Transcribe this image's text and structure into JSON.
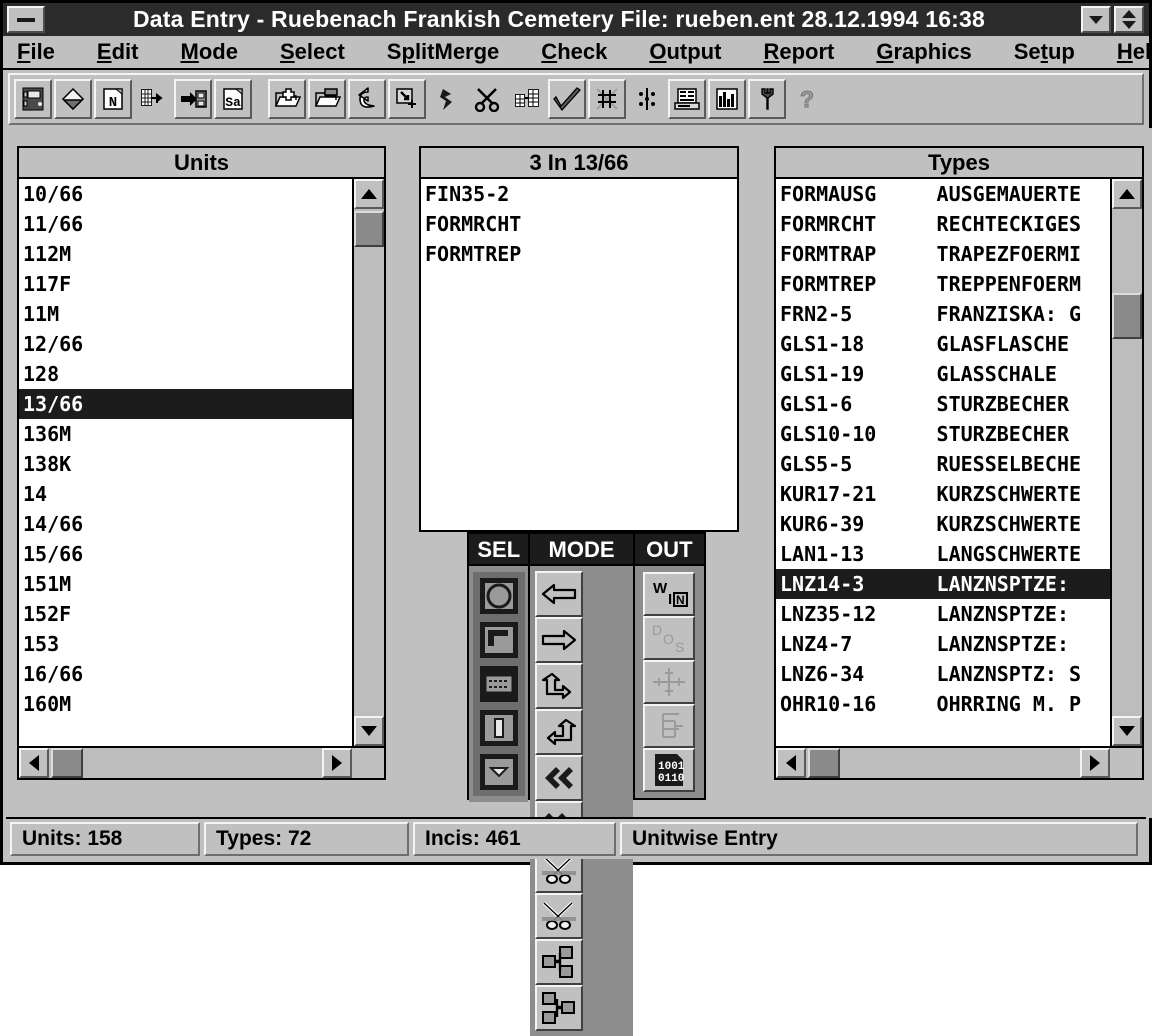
{
  "window": {
    "title": "Data Entry - Ruebenach Frankish Cemetery File: rueben.ent 28.12.1994 16:38",
    "minimize_icon": "minimize-icon",
    "restore_icon": "chevron-down-icon",
    "maximize_icon": "up-down-arrow-icon"
  },
  "menubar": {
    "items": [
      {
        "label": "File",
        "accel": "F"
      },
      {
        "label": "Edit",
        "accel": "E"
      },
      {
        "label": "Mode",
        "accel": "M"
      },
      {
        "label": "Select",
        "accel": "S"
      },
      {
        "label": "SplitMerge",
        "accel": "p"
      },
      {
        "label": "Check",
        "accel": "C"
      },
      {
        "label": "Output",
        "accel": "O"
      },
      {
        "label": "Report",
        "accel": "R"
      },
      {
        "label": "Graphics",
        "accel": "G"
      },
      {
        "label": "Setup",
        "accel": "t"
      },
      {
        "label": "Help",
        "accel": "H"
      }
    ]
  },
  "toolbar": {
    "buttons": [
      {
        "name": "save-file-icon"
      },
      {
        "name": "eraser-icon"
      },
      {
        "name": "new-note-icon"
      },
      {
        "name": "grid-insert-icon"
      },
      {
        "name": "export-to-disk-icon"
      },
      {
        "name": "save-as-icon"
      },
      {
        "name": "add-record-folder-icon"
      },
      {
        "name": "open-folder-icon"
      },
      {
        "name": "undo-arrow-icon"
      },
      {
        "name": "add-selection-icon"
      },
      {
        "name": "split-icon"
      },
      {
        "name": "scissors-cut-icon"
      },
      {
        "name": "merge-table-icon"
      },
      {
        "name": "check-mark-icon"
      },
      {
        "name": "seriation-grid-icon"
      },
      {
        "name": "correspondence-dots-icon"
      },
      {
        "name": "printer-icon"
      },
      {
        "name": "bar-chart-icon"
      },
      {
        "name": "wrench-setup-icon"
      },
      {
        "name": "help-question-icon"
      }
    ]
  },
  "units_panel": {
    "title": "Units",
    "selected": "13/66",
    "items": [
      "10/66",
      "11/66",
      "112M",
      "117F",
      "11M",
      "12/66",
      "128",
      "13/66",
      "136M",
      "138K",
      "14",
      "14/66",
      "15/66",
      "151M",
      "152F",
      "153",
      "16/66",
      "160M"
    ],
    "scroll_up_icon": "arrow-up-icon",
    "scroll_down_icon": "arrow-down-icon",
    "scroll_left_icon": "arrow-left-icon",
    "scroll_right_icon": "arrow-right-icon"
  },
  "incidence_panel": {
    "title": "3 In 13/66",
    "items": [
      "FIN35-2",
      "FORMRCHT",
      "FORMTREP"
    ]
  },
  "types_panel": {
    "title": "Types",
    "selected": "LNZ14-3",
    "items": [
      {
        "code": "FORMAUSG",
        "desc": "AUSGEMAUERTE"
      },
      {
        "code": "FORMRCHT",
        "desc": "RECHTECKIGES"
      },
      {
        "code": "FORMTRAP",
        "desc": "TRAPEZFOERMI"
      },
      {
        "code": "FORMTREP",
        "desc": "TREPPENFOERM"
      },
      {
        "code": "FRN2-5",
        "desc": "FRANZISKA: G"
      },
      {
        "code": "GLS1-18",
        "desc": "GLASFLASCHE"
      },
      {
        "code": "GLS1-19",
        "desc": "GLASSCHALE"
      },
      {
        "code": "GLS1-6",
        "desc": "STURZBECHER"
      },
      {
        "code": "GLS10-10",
        "desc": "STURZBECHER"
      },
      {
        "code": "GLS5-5",
        "desc": "RUESSELBECHE"
      },
      {
        "code": "KUR17-21",
        "desc": "KURZSCHWERTE"
      },
      {
        "code": "KUR6-39",
        "desc": "KURZSCHWERTE"
      },
      {
        "code": "LAN1-13",
        "desc": "LANGSCHWERTE"
      },
      {
        "code": "LNZ14-3",
        "desc": "LANZNSPTZE:"
      },
      {
        "code": "LNZ35-12",
        "desc": "LANZNSPTZE:"
      },
      {
        "code": "LNZ4-7",
        "desc": "LANZNSPTZE:"
      },
      {
        "code": "LNZ6-34",
        "desc": "LANZNSPTZ: S"
      },
      {
        "code": "OHR10-16",
        "desc": "OHRRING M. P"
      }
    ],
    "scroll_up_icon": "arrow-up-icon",
    "scroll_down_icon": "arrow-down-icon",
    "scroll_left_icon": "arrow-left-icon",
    "scroll_right_icon": "arrow-right-icon"
  },
  "palette": {
    "columns": [
      {
        "caption": "SEL",
        "buttons": [
          {
            "name": "select-ellipse-icon"
          },
          {
            "name": "select-rectangle-icon"
          },
          {
            "name": "select-rows-icon"
          },
          {
            "name": "select-column-icon"
          },
          {
            "name": "select-cell-icon"
          }
        ]
      },
      {
        "caption": "MODE",
        "buttons": [
          {
            "name": "move-left-icon"
          },
          {
            "name": "move-right-icon"
          },
          {
            "name": "rotate-up-left-icon"
          },
          {
            "name": "rotate-up-right-icon"
          },
          {
            "name": "fast-left-icon"
          },
          {
            "name": "fast-right-icon"
          },
          {
            "name": "split-scissors-left-icon"
          },
          {
            "name": "split-scissors-right-icon"
          },
          {
            "name": "merge-blocks-left-icon"
          },
          {
            "name": "merge-blocks-right-icon"
          }
        ]
      },
      {
        "caption": "OUT",
        "buttons": [
          {
            "name": "windows-output-icon",
            "enabled": true
          },
          {
            "name": "dos-output-icon",
            "enabled": false
          },
          {
            "name": "plot-crosshair-icon",
            "enabled": false
          },
          {
            "name": "dendrogram-icon",
            "enabled": false
          },
          {
            "name": "binary-file-icon",
            "enabled": true
          }
        ]
      }
    ]
  },
  "statusbar": {
    "units": "Units: 158",
    "types": "Types: 72",
    "incis": "Incis: 461",
    "mode": "Unitwise Entry"
  }
}
